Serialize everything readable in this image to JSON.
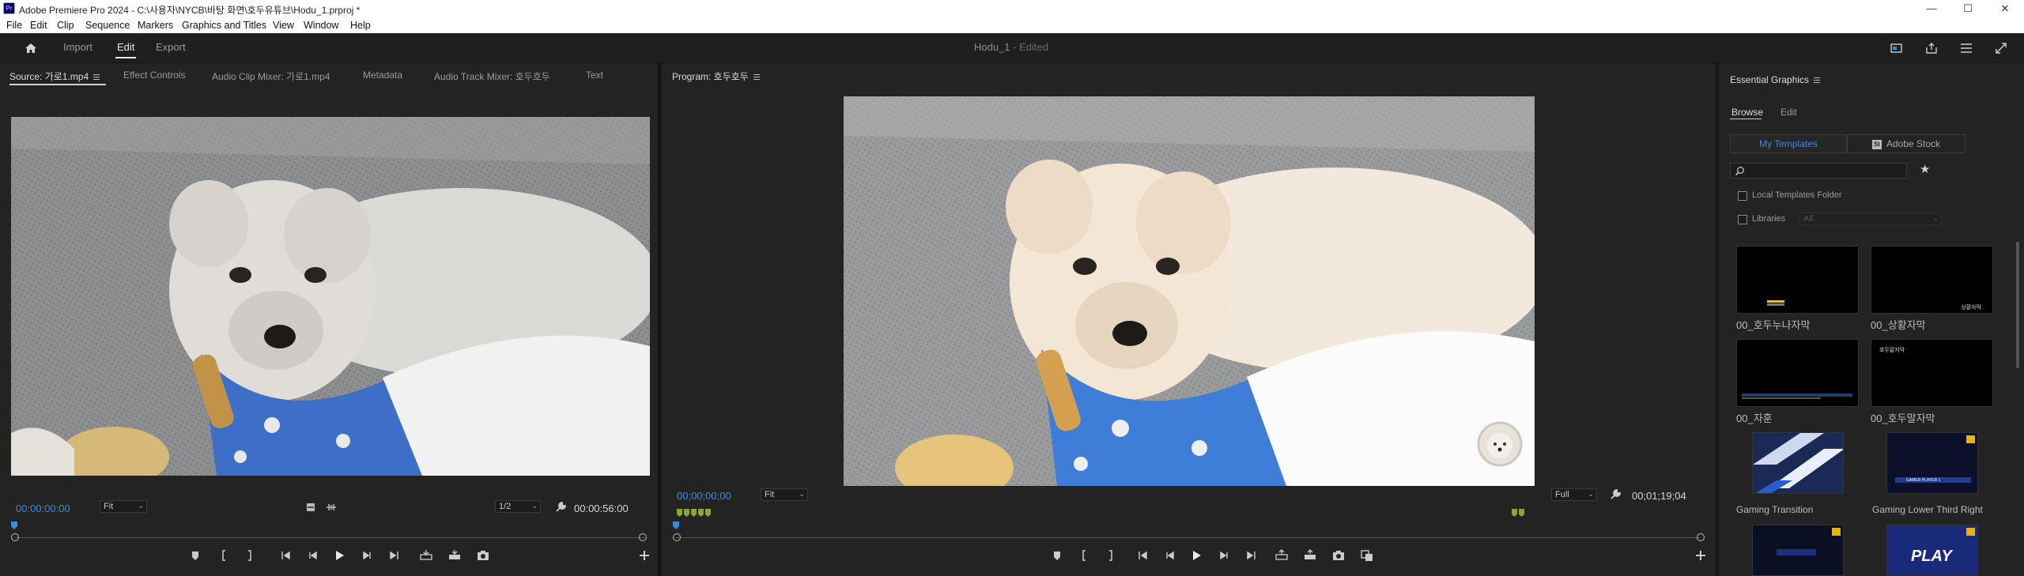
{
  "titlebar": {
    "app_icon": "Pr",
    "title": "Adobe Premiere Pro 2024 - C:\\사용자\\NYCB\\바탕 화면\\호두유튜브\\Hodu_1.prproj *",
    "minimize": "—",
    "maximize": "☐",
    "close": "✕"
  },
  "menubar": {
    "items": [
      "File",
      "Edit",
      "Clip",
      "Sequence",
      "Markers",
      "Graphics and Titles",
      "View",
      "Window",
      "Help"
    ]
  },
  "workspace": {
    "tabs": [
      "Import",
      "Edit",
      "Export"
    ],
    "active_tab": "Edit",
    "project_name": "Hodu_1",
    "project_status": "- Edited",
    "icons": [
      "home-icon",
      "quick-export-icon",
      "share-icon",
      "workspaces-menu-icon",
      "fullscreen-icon"
    ]
  },
  "source_panel": {
    "tabs": [
      "Source: 가로1.mp4",
      "Effect Controls",
      "Audio Clip Mixer: 가로1.mp4",
      "Metadata",
      "Audio Track Mixer: 호두호두",
      "Text"
    ],
    "active_tab": "Source: 가로1.mp4",
    "timecode": "00:00:00:00",
    "zoom": "Fit",
    "resolution": "1/2",
    "duration": "00:00:56:00"
  },
  "program_panel": {
    "tab": "Program: 호두호두",
    "timecode": "00;00;00;00",
    "zoom": "Fit",
    "resolution": "Full",
    "duration": "00;01;19;04"
  },
  "essential_graphics": {
    "title": "Essential Graphics",
    "subtabs": [
      "Browse",
      "Edit"
    ],
    "active_subtab": "Browse",
    "segments": [
      "My Templates",
      "Adobe Stock"
    ],
    "active_segment": "My Templates",
    "search_placeholder": "",
    "local_templates": "Local Templates Folder",
    "libraries": "Libraries",
    "libraries_value": "All",
    "templates": [
      {
        "name": "00_호두누나자막"
      },
      {
        "name": "00_상황자막"
      },
      {
        "name": "00_자훈"
      },
      {
        "name": "00_호두말자막"
      },
      {
        "name": "Gaming Transition"
      },
      {
        "name": "Gaming Lower Third Right"
      },
      {
        "name": ""
      },
      {
        "name": ""
      }
    ],
    "thumb_texts": {
      "t2": "상황자막",
      "t4": "호두말자막",
      "t6": "GAMER PLAYER 1",
      "t8": "PLAY"
    }
  },
  "colors": {
    "accent_blue": "#3a8be8",
    "marker_green": "#8aa63a",
    "panel_bg": "#232323"
  }
}
